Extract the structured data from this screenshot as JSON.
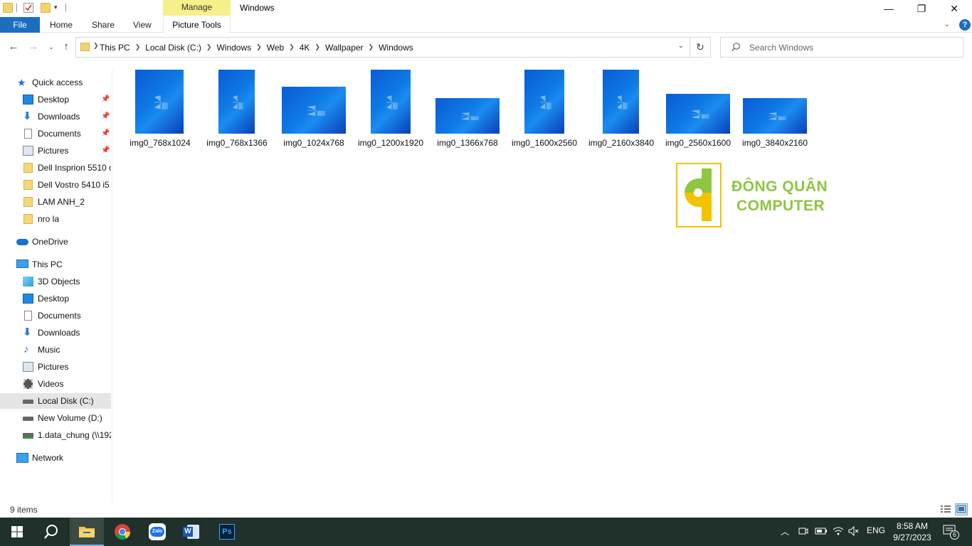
{
  "window": {
    "title": "Windows",
    "manage_label": "Manage",
    "minimize_glyph": "—",
    "restore_glyph": "❐",
    "close_glyph": "✕"
  },
  "ribbon": {
    "file": "File",
    "home": "Home",
    "share": "Share",
    "view": "View",
    "picture_tools": "Picture Tools",
    "help": "?"
  },
  "address": {
    "crumbs": [
      "This PC",
      "Local Disk (C:)",
      "Windows",
      "Web",
      "4K",
      "Wallpaper",
      "Windows"
    ]
  },
  "search": {
    "placeholder": "Search Windows"
  },
  "nav": {
    "quick_access": "Quick access",
    "qa_desktop": "Desktop",
    "qa_downloads": "Downloads",
    "qa_documents": "Documents",
    "qa_pictures": "Pictures",
    "qa_folder1": "Dell Insprion 5510 c",
    "qa_folder2": "Dell Vostro 5410 i5",
    "qa_folder3": "LAM ANH_2",
    "qa_folder4": "nro la",
    "onedrive": "OneDrive",
    "this_pc": "This PC",
    "pc_3d": "3D Objects",
    "pc_desktop": "Desktop",
    "pc_documents": "Documents",
    "pc_downloads": "Downloads",
    "pc_music": "Music",
    "pc_pictures": "Pictures",
    "pc_videos": "Videos",
    "pc_c": "Local Disk (C:)",
    "pc_d": "New Volume (D:)",
    "pc_net": "1.data_chung (\\\\192",
    "network": "Network"
  },
  "files": [
    "img0_768x1024",
    "img0_768x1366",
    "img0_1024x768",
    "img0_1200x1920",
    "img0_1366x768",
    "img0_1600x2560",
    "img0_2160x3840",
    "img0_2560x1600",
    "img0_3840x2160"
  ],
  "watermark": {
    "line1": "ĐÔNG QUÂN",
    "line2": "COMPUTER"
  },
  "status": {
    "item_count": "9 items"
  },
  "taskbar": {
    "lang": "ENG",
    "time": "8:58 AM",
    "date": "9/27/2023",
    "notification_count": "6",
    "ps_label": "Ps"
  }
}
